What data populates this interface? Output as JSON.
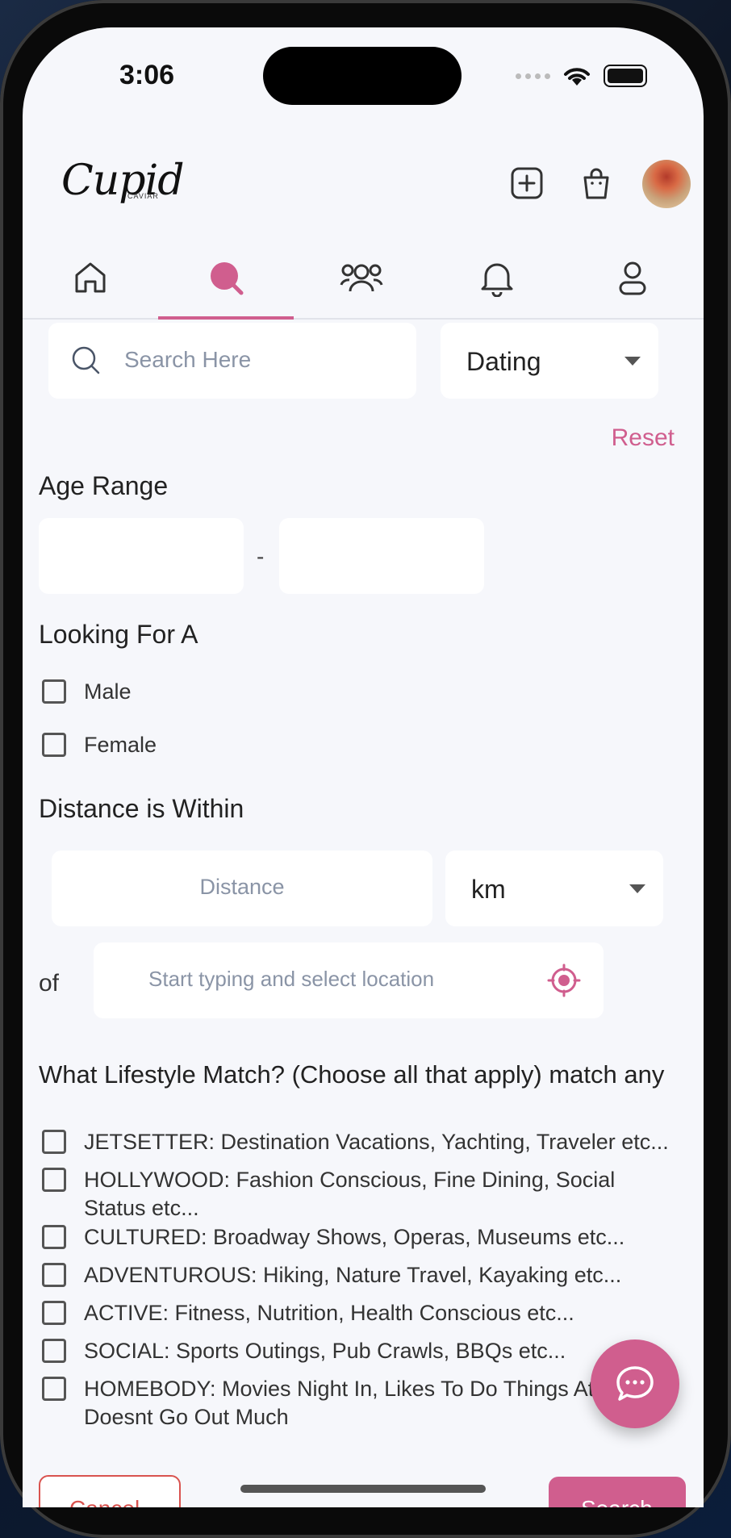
{
  "status_bar": {
    "time": "3:06"
  },
  "header": {
    "logo_text": "Cupid",
    "logo_subtext": "CAVIAR"
  },
  "nav": {
    "active_tab": "search"
  },
  "search": {
    "placeholder": "Search Here",
    "category_value": "Dating"
  },
  "filters": {
    "reset_label": "Reset",
    "age_range_title": "Age Range",
    "age_separator": "-",
    "looking_for_title": "Looking For A",
    "looking_for_options": [
      "Male",
      "Female"
    ],
    "distance_title": "Distance is Within",
    "distance_placeholder": "Distance",
    "distance_unit": "km",
    "of_label": "of",
    "location_placeholder": "Start typing and select location",
    "lifestyle_title": "What Lifestyle Match? (Choose all that apply) match any",
    "lifestyle_options": [
      "JETSETTER: Destination Vacations, Yachting, Traveler etc...",
      "HOLLYWOOD: Fashion Conscious, Fine Dining, Social Status etc...",
      "CULTURED: Broadway Shows, Operas, Museums etc...",
      "ADVENTUROUS: Hiking, Nature Travel, Kayaking etc...",
      "ACTIVE: Fitness, Nutrition, Health Conscious etc...",
      "SOCIAL: Sports Outings, Pub Crawls, BBQs etc...",
      "HOMEBODY: Movies Night In, Likes To Do Things At Home, Doesnt Go Out Much"
    ]
  },
  "actions": {
    "cancel_label": "Cancel",
    "search_label": "Search"
  },
  "colors": {
    "accent": "#d05e8e",
    "background": "#f6f7fb",
    "cancel": "#d9534f"
  }
}
